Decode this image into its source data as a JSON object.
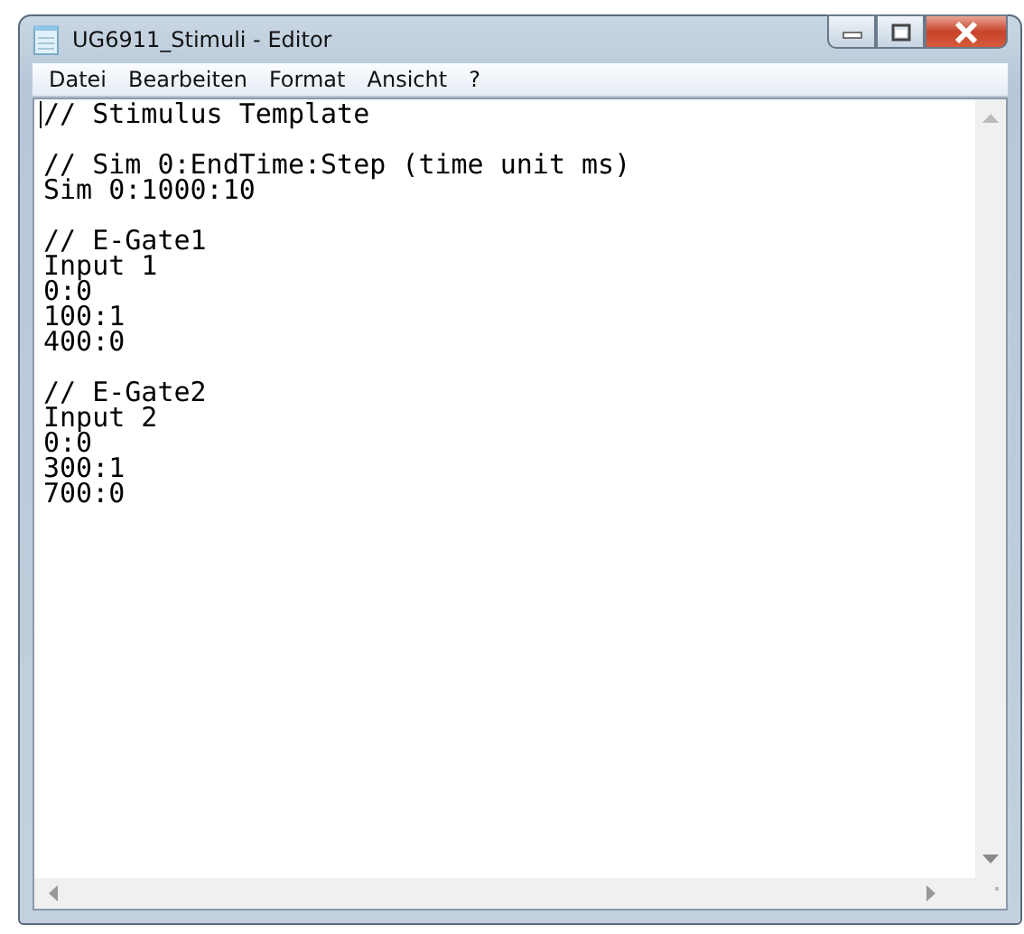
{
  "window": {
    "title": "UG6911_Stimuli - Editor"
  },
  "menu": [
    "Datei",
    "Bearbeiten",
    "Format",
    "Ansicht",
    "?"
  ],
  "editor": {
    "blocks": [
      [
        "// Stimulus Template"
      ],
      [
        "// Sim 0:EndTime:Step (time unit ms)",
        "Sim 0:1000:10"
      ],
      [
        "// E-Gate1",
        "Input 1",
        "0:0",
        "100:1",
        "400:0"
      ],
      [
        "// E-Gate2",
        "Input 2",
        "0:0",
        "300:1",
        "700:0"
      ]
    ]
  }
}
